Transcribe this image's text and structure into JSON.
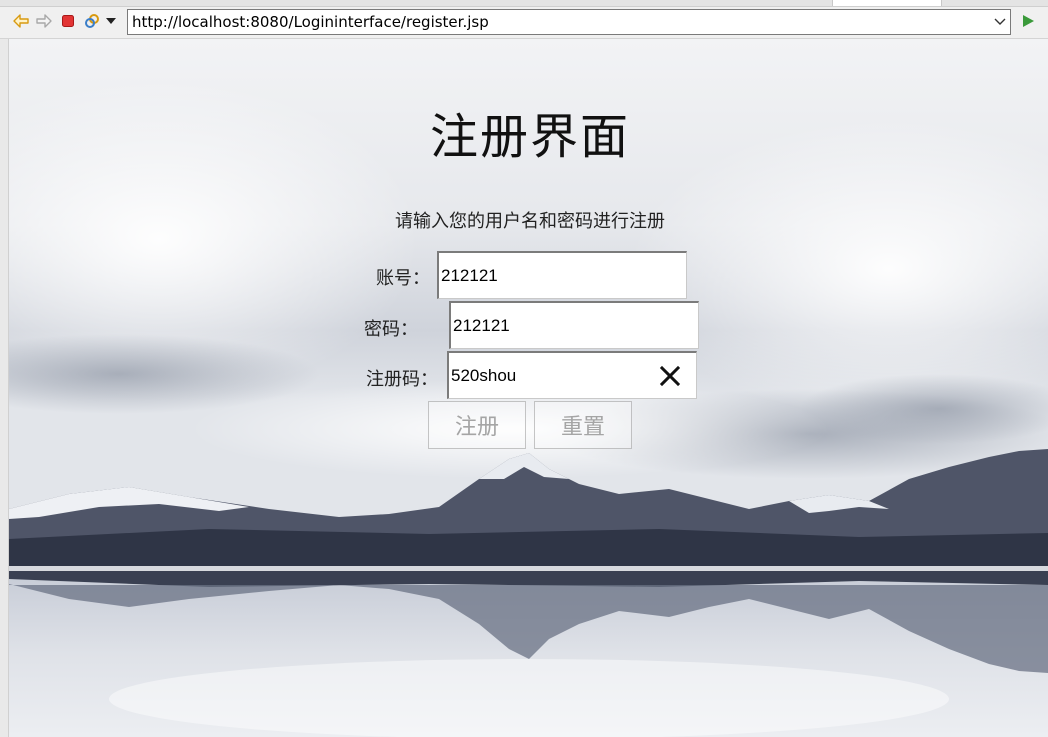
{
  "browser": {
    "url": "http://localhost:8080/Logininterface/register.jsp",
    "icons": [
      "back-icon",
      "forward-icon",
      "stop-icon",
      "refresh-icon",
      "menu-dropdown-icon",
      "url-dropdown-icon",
      "go-icon"
    ]
  },
  "page": {
    "title": "注册界面",
    "subtitle": "请输入您的用户名和密码进行注册"
  },
  "form": {
    "account_label": "账号：",
    "account_value": "212121",
    "password_label": "密码：",
    "password_value": "212121",
    "regcode_label": "注册码：",
    "regcode_value": "520shou",
    "register_button": "注册",
    "reset_button": "重置"
  },
  "colors": {
    "go_green": "#3a9a3a",
    "nav_arrow": "#e0a020",
    "stop_red": "#d83030"
  }
}
